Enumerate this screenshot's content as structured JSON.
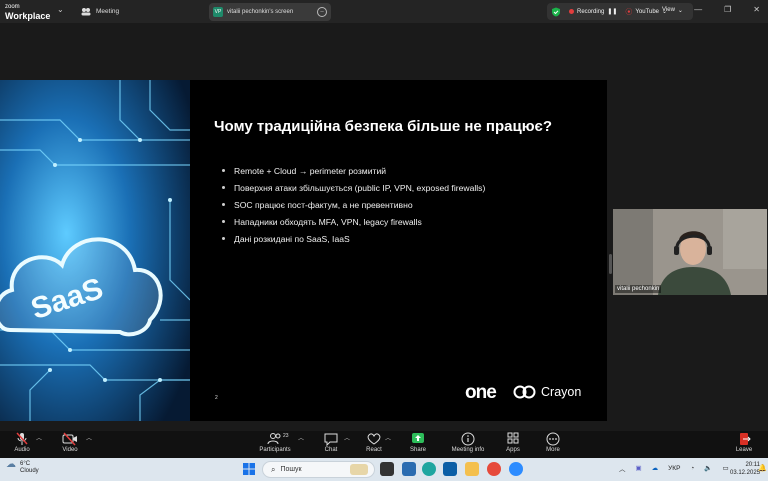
{
  "titlebar": {
    "logo_line1": "zoom",
    "logo_line2": "Workplace",
    "meeting_label": "Meeting",
    "screen_tab_avatar": "VP",
    "screen_tab_label": "vitalii pechonkin's screen",
    "recording_label": "Recording",
    "stream_label": "YouTube",
    "view_label": "View"
  },
  "slide": {
    "title": "Чому традиційна безпека більше не працює?",
    "bullets": [
      "Remote + Cloud → perimeter розмитий",
      "Поверхня атаки збільшується (public IP, VPN, exposed firewalls)",
      "SOC працює пост-фактум, а не превентивно",
      "Нападники обходять MFA, VPN, legacy firewalls",
      "Дані розкидані по SaaS, IaaS"
    ],
    "image_word": "SaaS",
    "slide_number": "2",
    "brand_one": "one",
    "brand_crayon": "Crayon"
  },
  "video": {
    "participant_name": "vitalii pechonkin"
  },
  "toolbar": {
    "audio": "Audio",
    "video": "Video",
    "participants": "Participants",
    "participants_count": "23",
    "chat": "Chat",
    "react": "React",
    "share": "Share",
    "meeting_info": "Meeting info",
    "apps": "Apps",
    "more": "More",
    "leave": "Leave"
  },
  "taskbar": {
    "temperature": "6°C",
    "weather": "Cloudy",
    "search_placeholder": "Пошук",
    "language": "УКР",
    "time": "20:11",
    "date": "03.12.2025"
  },
  "colors": {
    "accent_green": "#1bb34a",
    "record_red": "#e23d3d",
    "leave_red": "#d93025",
    "share_green": "#2dbd5a"
  }
}
